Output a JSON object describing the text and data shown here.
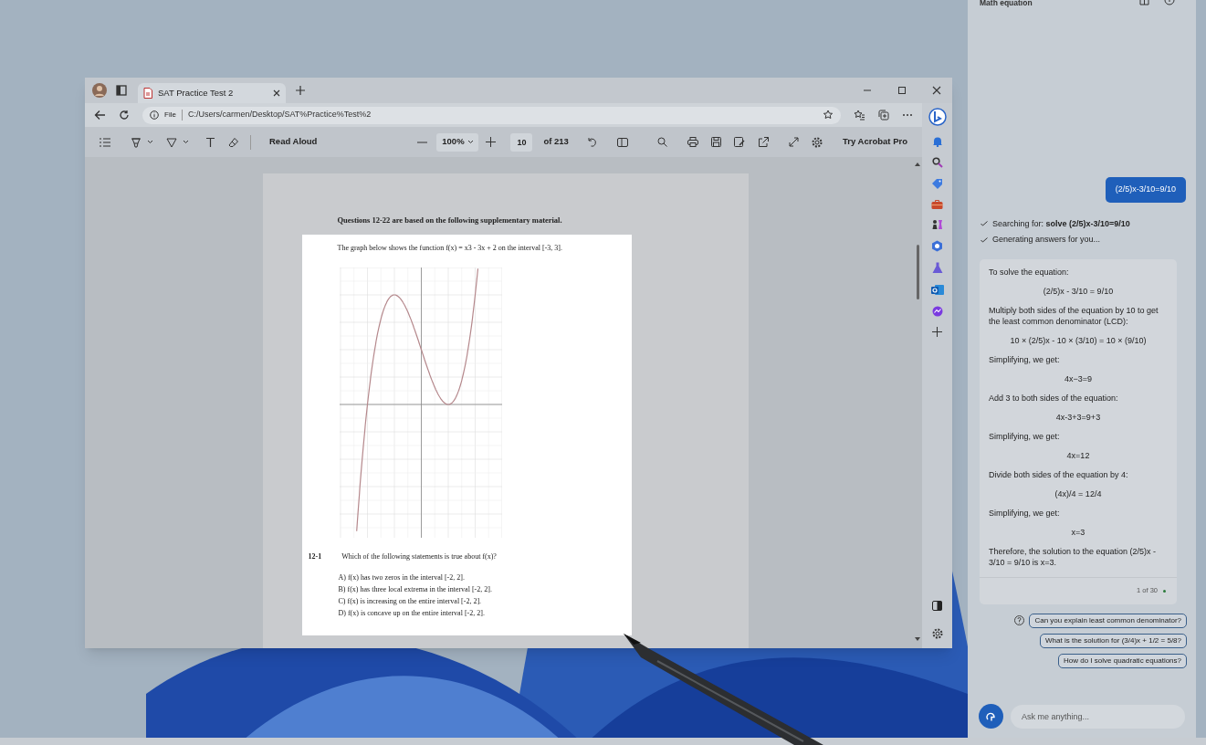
{
  "browser": {
    "tab_title": "SAT Practice Test 2",
    "address_label": "File",
    "address": "C:/Users/carmen/Desktop/SAT%Practice%Test%2",
    "pdf_toolbar": {
      "read_aloud": "Read Aloud",
      "zoom": "100%",
      "page": "10",
      "page_count": "of 213",
      "acrobat": "Try Acrobat Pro"
    },
    "pdf": {
      "heading": "Questions 12-22 are based on the following supplementary material.",
      "intro": "The graph below shows the function f(x) = x3 - 3x + 2 on the interval [-3, 3].",
      "question_number": "12-1",
      "question": "Which of the following statements is true about f(x)?",
      "options": [
        "A) f(x) has two zeros in the interval [-2, 2].",
        "B) f(x) has three local extrema in the interval [-2, 2].",
        "C) f(x) is increasing on the entire interval [-2, 2].",
        "D) f(x) is concave up on the entire interval [-2, 2]."
      ]
    }
  },
  "chat": {
    "title": "Math equation",
    "user_message": "(2/5)x-3/10=9/10",
    "status": [
      "Searching for: **solve (2/5)x-3/10=9/10**",
      "Generating answers for you..."
    ],
    "answer": [
      {
        "kind": "text",
        "text": "To solve the equation:"
      },
      {
        "kind": "equation",
        "text": "(2/5)x - 3/10 = 9/10"
      },
      {
        "kind": "text",
        "text": "Multiply both sides of the equation by 10 to get the least common denominator (LCD):"
      },
      {
        "kind": "equation",
        "text": "10 × (2/5)x - 10 × (3/10) = 10 × (9/10)"
      },
      {
        "kind": "text",
        "text": "Simplifying, we get:"
      },
      {
        "kind": "equation",
        "text": "4x−3=9"
      },
      {
        "kind": "text",
        "text": "Add 3 to both sides of the equation:"
      },
      {
        "kind": "equation",
        "text": "4x-3+3=9+3"
      },
      {
        "kind": "text",
        "text": "Simplifying, we get:"
      },
      {
        "kind": "equation",
        "text": "4x=12"
      },
      {
        "kind": "text",
        "text": "Divide both sides of the equation by 4:"
      },
      {
        "kind": "equation",
        "text": "(4x)/4 = 12/4"
      },
      {
        "kind": "text",
        "text": "Simplifying, we get:"
      },
      {
        "kind": "equation",
        "text": "x=3"
      },
      {
        "kind": "text",
        "text": "Therefore, the solution to the equation (2/5)x - 3/10 = 9/10 is x=3."
      }
    ],
    "counter": "1 of 30",
    "suggestions": [
      "Can you explain least common denominator?",
      "What is the solution for (3/4)x + 1/2 = 5/8?",
      "How do I solve quadratic equations?"
    ],
    "input": {
      "placeholder": "Ask me anything..."
    }
  }
}
